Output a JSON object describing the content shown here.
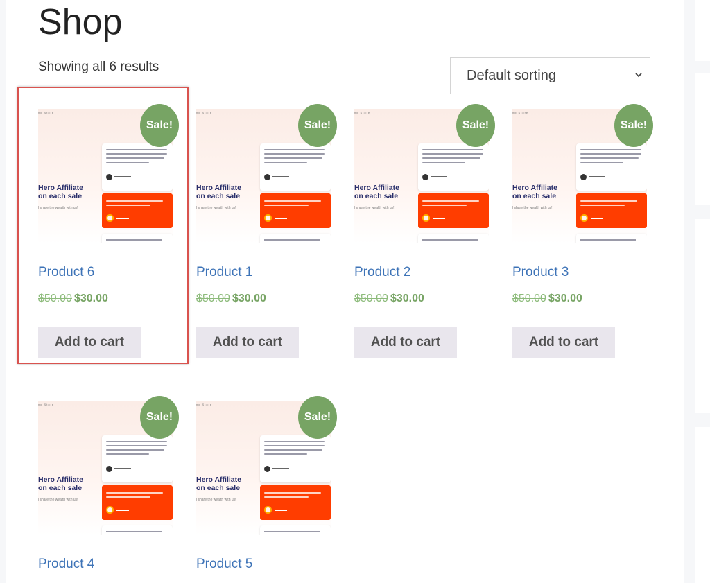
{
  "page": {
    "title": "Shop",
    "result_count": "Showing all 6 results"
  },
  "sort": {
    "selected": "Default sorting"
  },
  "thumbnail": {
    "hero_line1": "Hero Affiliate",
    "hero_line2": "on each sale",
    "hero_sub": "l share the wealth with us!",
    "nav_text": "ng   Store"
  },
  "products": [
    {
      "name": "Product 6",
      "regular_price": "$50.00",
      "sale_price": "$30.00",
      "badge": "Sale!",
      "button": "Add to cart"
    },
    {
      "name": "Product 1",
      "regular_price": "$50.00",
      "sale_price": "$30.00",
      "badge": "Sale!",
      "button": "Add to cart"
    },
    {
      "name": "Product 2",
      "regular_price": "$50.00",
      "sale_price": "$30.00",
      "badge": "Sale!",
      "button": "Add to cart"
    },
    {
      "name": "Product 3",
      "regular_price": "$50.00",
      "sale_price": "$30.00",
      "badge": "Sale!",
      "button": "Add to cart"
    },
    {
      "name": "Product 4",
      "badge": "Sale!"
    },
    {
      "name": "Product 5",
      "badge": "Sale!"
    }
  ],
  "colors": {
    "sale_badge": "#77a464",
    "product_link": "#3d73b7",
    "highlight": "#d9534f",
    "button_bg": "#e9e6ed"
  }
}
